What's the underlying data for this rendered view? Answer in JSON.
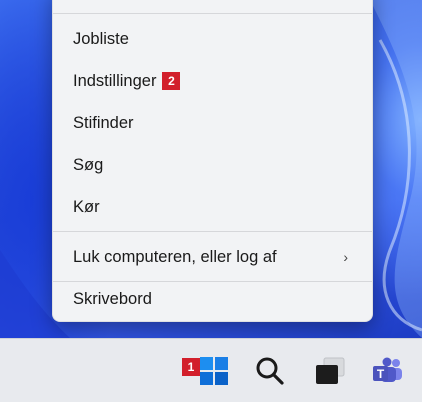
{
  "menu": {
    "items": [
      {
        "label": "Jobliste"
      },
      {
        "label": "Indstillinger",
        "badge": "2"
      },
      {
        "label": "Stifinder"
      },
      {
        "label": "Søg"
      },
      {
        "label": "Kør"
      },
      {
        "label": "Luk computeren, eller log af",
        "has_submenu": true
      },
      {
        "label": "Skrivebord"
      }
    ]
  },
  "taskbar": {
    "start_badge": "1",
    "icons": [
      "windows-start-icon",
      "search-icon",
      "task-view-icon",
      "teams-icon"
    ]
  },
  "colors": {
    "badge": "#d21f2b",
    "menu_bg": "#f2f3f5",
    "taskbar_bg": "#e8eaee",
    "windows_blue": "#0a74da"
  }
}
